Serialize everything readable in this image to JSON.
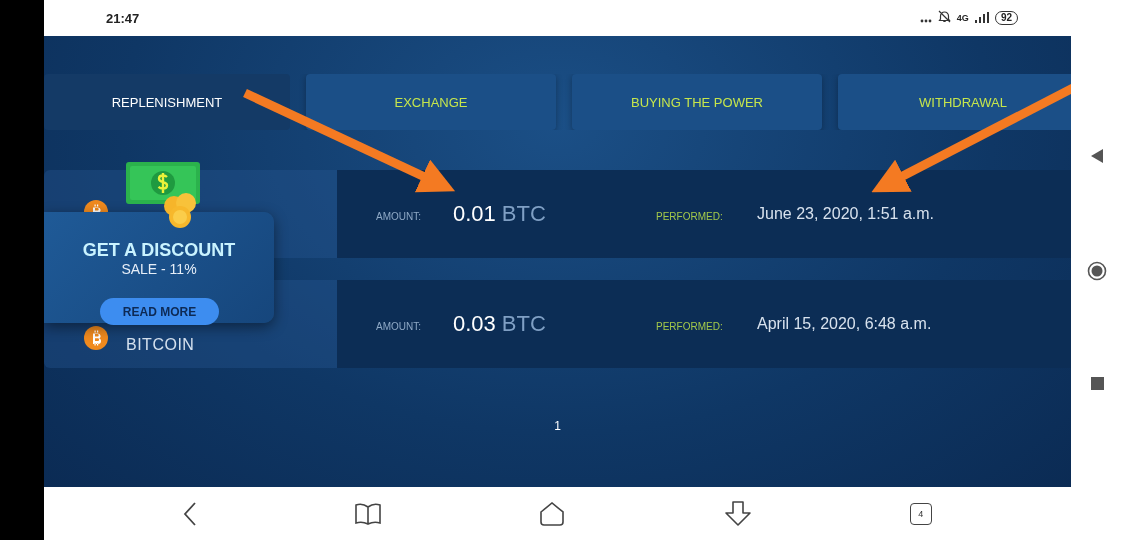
{
  "status_bar": {
    "time": "21:47",
    "network": "4G",
    "battery": "92"
  },
  "tabs": [
    {
      "label": "REPLENISHMENT",
      "selected": true
    },
    {
      "label": "EXCHANGE",
      "selected": false
    },
    {
      "label": "BUYING THE POWER",
      "selected": false
    },
    {
      "label": "WITHDRAWAL",
      "selected": false
    }
  ],
  "transactions": [
    {
      "amount_label": "AMOUNT:",
      "amount": "0.01",
      "unit": "BTC",
      "performed_label": "PERFORMED:",
      "performed": "June 23, 2020, 1:51 a.m."
    },
    {
      "coin": "BITCOIN",
      "amount_label": "AMOUNT:",
      "amount": "0.03",
      "unit": "BTC",
      "performed_label": "PERFORMED:",
      "performed": "April 15, 2020, 6:48 a.m."
    }
  ],
  "promo": {
    "title": "GET A DISCOUNT",
    "subtitle": "SALE - 11%",
    "button": "READ MORE"
  },
  "pagination": [
    {
      "label": "1",
      "selected": true
    }
  ],
  "browser_bar": {
    "tabs_count": "4"
  }
}
